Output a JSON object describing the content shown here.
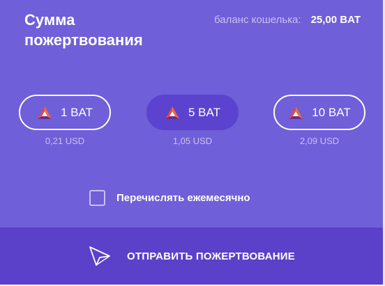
{
  "header": {
    "title": "Сумма пожертвования",
    "balance_label": "баланс кошелька:",
    "balance_value": "25,00 BAT"
  },
  "amounts": [
    {
      "label": "1 BAT",
      "usd": "0,21 USD",
      "selected": false,
      "icon": "bat-logo-icon"
    },
    {
      "label": "5 BAT",
      "usd": "1,05 USD",
      "selected": true,
      "icon": "bat-logo-icon"
    },
    {
      "label": "10 BAT",
      "usd": "2,09 USD",
      "selected": false,
      "icon": "bat-logo-icon"
    }
  ],
  "monthly": {
    "label": "Перечислять ежемесячно",
    "checked": false
  },
  "send": {
    "label": "ОТПРАВИТЬ ПОЖЕРТВОВАНИЕ",
    "icon": "paper-plane-icon"
  },
  "colors": {
    "panel": "#6f5fd8",
    "selected_pill": "#5b43cf",
    "send_bar": "#5b40c9",
    "muted_text": "#c7c0f2",
    "bat_orange": "#e8473f",
    "bat_purple": "#662d91"
  }
}
